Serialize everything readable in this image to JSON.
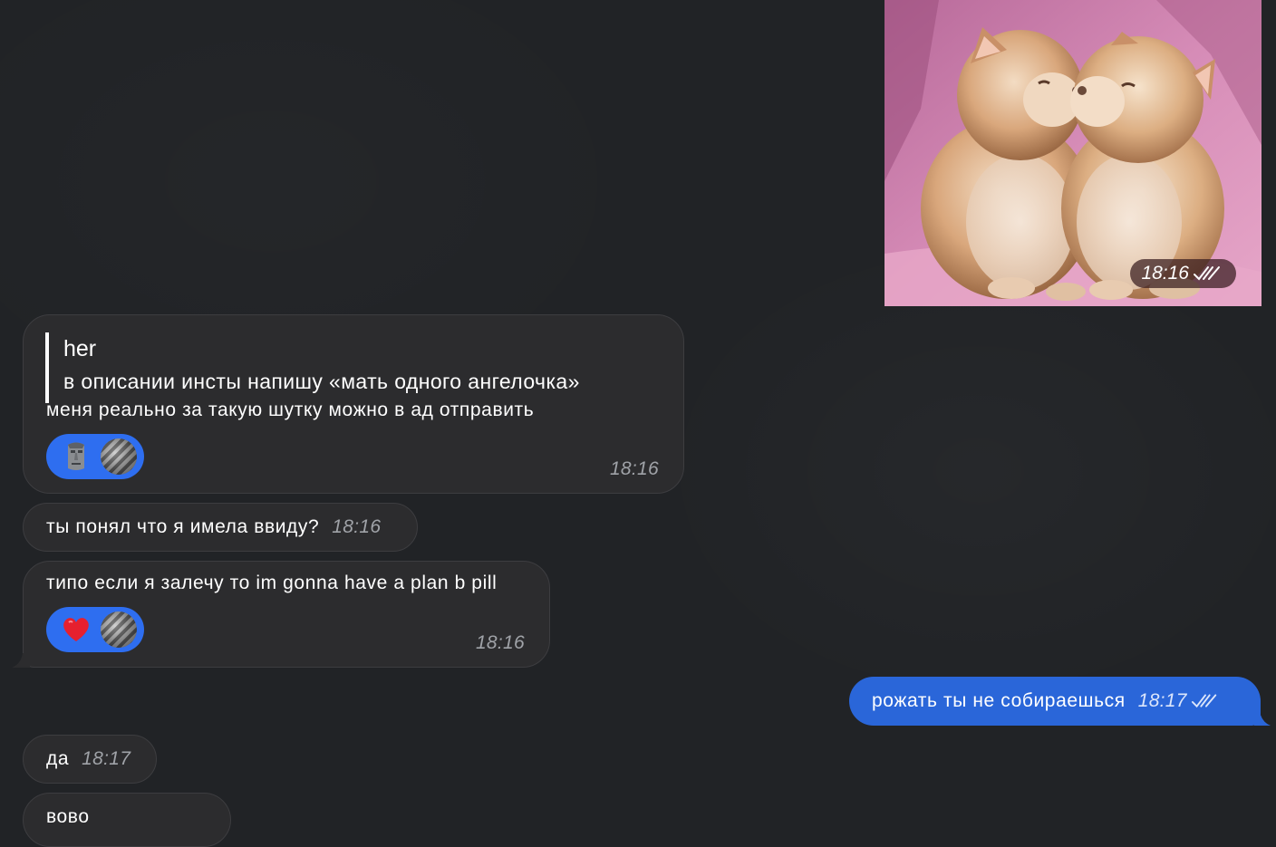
{
  "photo_message": {
    "alt_icon": "kittens-photo",
    "time": "18:16",
    "status_icon": "double-check-icon"
  },
  "messages": [
    {
      "reply": {
        "author": "her",
        "text": "в описании инсты напишу «мать одного ангелочка»"
      },
      "text": "меня реально за такую шутку можно в ад отправить",
      "reactions": [
        "moai-emoji",
        "avatar"
      ],
      "time": "18:16"
    },
    {
      "text": "ты понял что я имела ввиду?",
      "time": "18:16"
    },
    {
      "text": "типо если я залечу то im gonna have a plan b pill",
      "reactions": [
        "heart-emoji",
        "avatar"
      ],
      "time": "18:16"
    },
    {
      "text": "рожать ты не собираешься",
      "time": "18:17",
      "outgoing": true
    },
    {
      "text": "да",
      "time": "18:17"
    },
    {
      "text": "вово",
      "time": ""
    }
  ],
  "colors": {
    "background": "#212326",
    "incoming_bubble": "#2c2c2e",
    "outgoing_bubble": "#2a66d9",
    "reaction_pill": "#2e6ef0"
  }
}
